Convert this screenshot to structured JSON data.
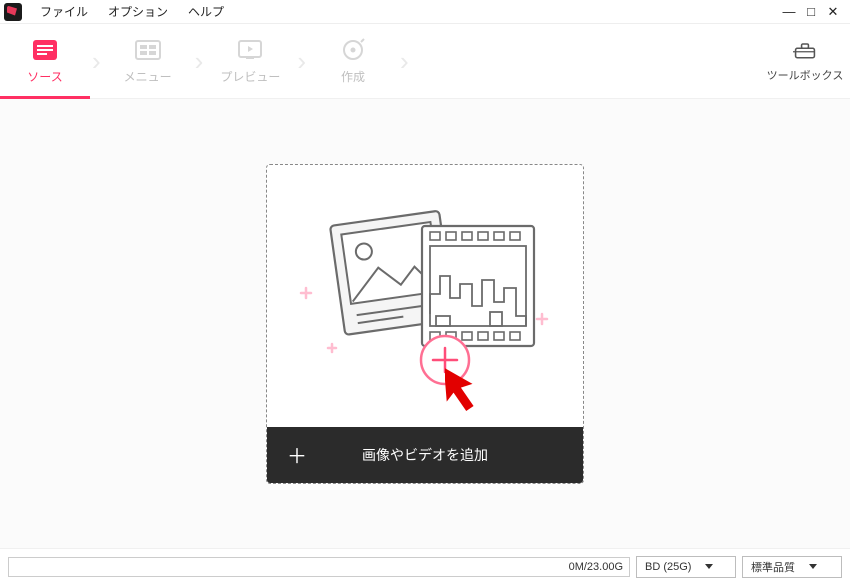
{
  "menu": {
    "file": "ファイル",
    "options": "オプション",
    "help": "ヘルプ"
  },
  "steps": {
    "source": "ソース",
    "menu": "メニュー",
    "preview": "プレビュー",
    "create": "作成"
  },
  "toolbox": {
    "label": "ツールボックス"
  },
  "drop": {
    "add_label": "画像やビデオを追加",
    "plus": "＋"
  },
  "footer": {
    "progress": "0M/23.00G",
    "disc_type": "BD (25G)",
    "quality": "標準品質"
  }
}
